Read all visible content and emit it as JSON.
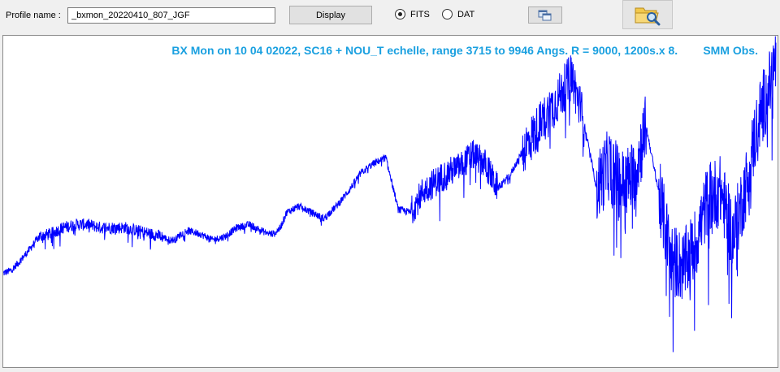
{
  "toolbar": {
    "profile_label": "Profile name :",
    "profile_value": "_bxmon_20220410_807_JGF",
    "display_label": "Display",
    "format_options": [
      {
        "label": "FITS",
        "selected": true
      },
      {
        "label": "DAT",
        "selected": false
      }
    ],
    "copy_icon": "copy-windows-icon",
    "open_icon": "folder-search-icon"
  },
  "plot": {
    "title": "BX Mon on 10 04 02022, SC16 + NOU_T echelle, range 3715 to 9946 Angs. R = 9000, 1200s.x 8.        SMM Obs.",
    "line_color": "#0000ff",
    "title_color": "#1aa0e0"
  },
  "chart_data": {
    "type": "line",
    "title": "BX Mon on 10 04 02022, SC16 + NOU_T echelle, range 3715 to 9946 Angs. R = 9000, 1200s.x 8.        SMM Obs.",
    "xlabel": "",
    "ylabel": "",
    "xlim": [
      3715,
      9946
    ],
    "series": [
      {
        "x": [
          3715,
          3780,
          3850,
          3930,
          4000,
          4100,
          4200,
          4300,
          4400,
          4500,
          4600,
          4700,
          4800,
          4900,
          5000,
          5050,
          5100,
          5150,
          5200,
          5300,
          5400,
          5500,
          5600,
          5700,
          5800,
          5850,
          5900,
          5950,
          6000,
          6100,
          6200,
          6300,
          6400,
          6500,
          6600,
          6700,
          6800,
          6900,
          7000,
          7100,
          7200,
          7300,
          7400,
          7500,
          7600,
          7700,
          7800,
          7900,
          8000,
          8100,
          8200,
          8300,
          8400,
          8500,
          8600,
          8700,
          8800,
          8900,
          9000,
          9100,
          9200,
          9300,
          9400,
          9500,
          9600,
          9700,
          9800,
          9900,
          9946
        ],
        "y": [
          0.3,
          0.31,
          0.34,
          0.38,
          0.42,
          0.43,
          0.45,
          0.46,
          0.46,
          0.45,
          0.45,
          0.45,
          0.44,
          0.43,
          0.42,
          0.41,
          0.41,
          0.43,
          0.44,
          0.43,
          0.41,
          0.42,
          0.45,
          0.46,
          0.44,
          0.43,
          0.43,
          0.45,
          0.5,
          0.52,
          0.5,
          0.48,
          0.52,
          0.57,
          0.63,
          0.66,
          0.68,
          0.51,
          0.5,
          0.57,
          0.6,
          0.63,
          0.65,
          0.69,
          0.66,
          0.58,
          0.62,
          0.7,
          0.76,
          0.82,
          0.88,
          0.95,
          0.79,
          0.58,
          0.66,
          0.59,
          0.62,
          0.78,
          0.57,
          0.35,
          0.32,
          0.4,
          0.55,
          0.57,
          0.42,
          0.58,
          0.8,
          0.92,
          1.0
        ]
      }
    ]
  }
}
